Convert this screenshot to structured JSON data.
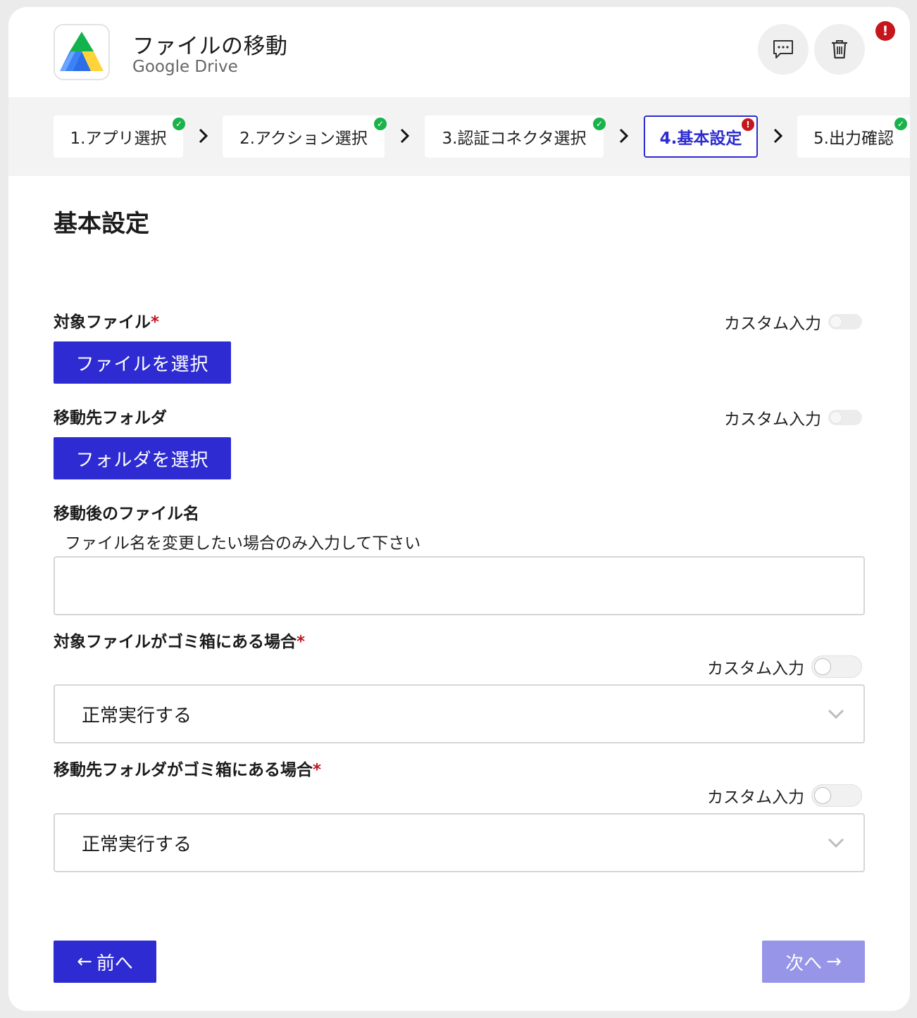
{
  "header": {
    "title": "ファイルの移動",
    "subtitle": "Google Drive",
    "logo_icon": "google-drive-logo",
    "alert_glyph": "!"
  },
  "steps": [
    {
      "label": "1.アプリ選択",
      "status": "complete"
    },
    {
      "label": "2.アクション選択",
      "status": "complete"
    },
    {
      "label": "3.認証コネクタ選択",
      "status": "complete"
    },
    {
      "label": "4.基本設定",
      "status": "error"
    },
    {
      "label": "5.出力確認",
      "status": "complete"
    }
  ],
  "form": {
    "section_title": "基本設定",
    "custom_input_label": "カスタム入力",
    "target_file": {
      "label": "対象ファイル",
      "required_mark": "*",
      "button": "ファイルを選択"
    },
    "dest_folder": {
      "label": "移動先フォルダ",
      "button": "フォルダを選択"
    },
    "new_name": {
      "label": "移動後のファイル名",
      "hint": "ファイル名を変更したい場合のみ入力して下さい",
      "value": ""
    },
    "file_in_trash": {
      "label": "対象ファイルがゴミ箱にある場合",
      "required_mark": "*",
      "selected": "正常実行する"
    },
    "folder_in_trash": {
      "label": "移動先フォルダがゴミ箱にある場合",
      "required_mark": "*",
      "selected": "正常実行する"
    }
  },
  "nav": {
    "prev_arrow": "←",
    "prev_label": "前へ",
    "next_label": "次へ",
    "next_arrow": "→"
  },
  "colors": {
    "primary": "#2d2bd1",
    "primary_disabled": "#9695e8",
    "error": "#c4161c",
    "success": "#19b24b"
  }
}
